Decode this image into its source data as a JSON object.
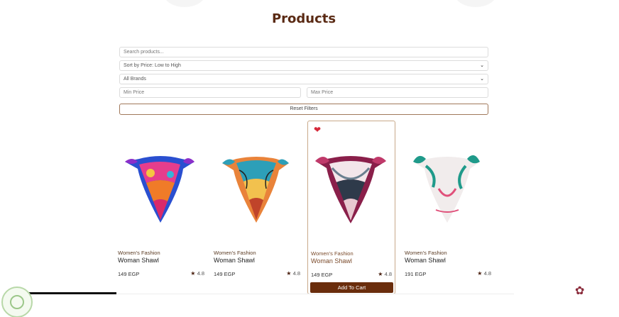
{
  "page": {
    "title": "Products"
  },
  "filters": {
    "search_placeholder": "Search products...",
    "sort_value": "Sort by Price: Low to High",
    "brand_value": "All Brands",
    "min_price_placeholder": "Min Price",
    "max_price_placeholder": "Max Price",
    "reset_label": "Reset Filters"
  },
  "products": [
    {
      "category": "Women's Fashion",
      "name": "Woman Shawl",
      "price": "149 EGP",
      "rating": "4.8",
      "favorited": false
    },
    {
      "category": "Women's Fashion",
      "name": "Woman Shawl",
      "price": "149 EGP",
      "rating": "4.8",
      "favorited": false
    },
    {
      "category": "Women's Fashion",
      "name": "Woman Shawl",
      "price": "149 EGP",
      "rating": "4.8",
      "favorited": true,
      "add_to_cart_label": "Add To Cart"
    },
    {
      "category": "Women's Fashion",
      "name": "Woman Shawl",
      "price": "191 EGP",
      "rating": "4.8",
      "favorited": false
    }
  ],
  "icons": {
    "heart": "heart-icon",
    "star": "star-icon",
    "chevron": "chevron-down-icon"
  },
  "colors": {
    "title": "#5a2a14",
    "cart_button": "#6a2d0c",
    "heart": "#d62839",
    "active_border": "#c9a98a"
  }
}
